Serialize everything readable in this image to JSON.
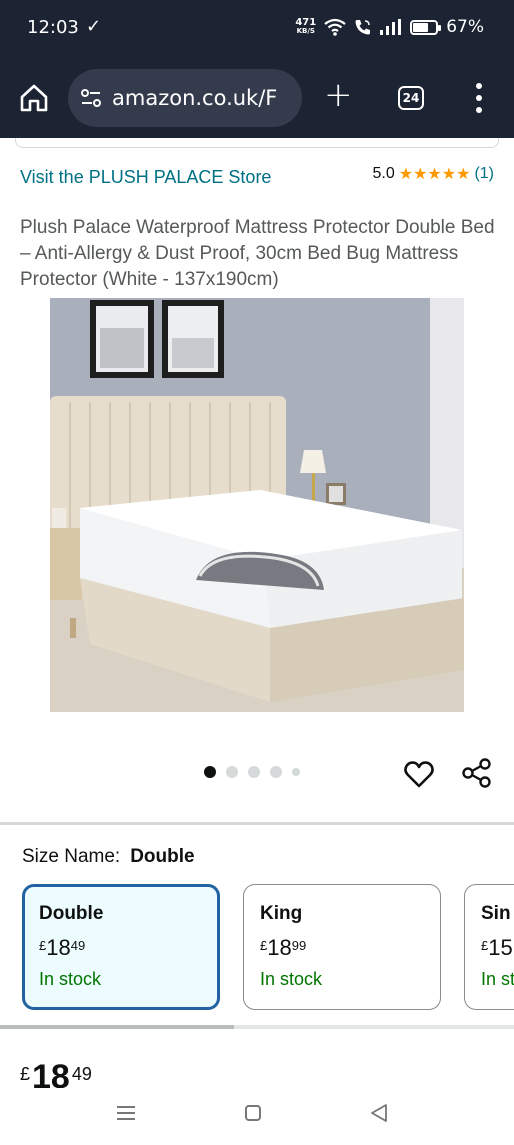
{
  "status_bar": {
    "time": "12:03",
    "check_glyph": "✓",
    "speed_value": "471",
    "speed_unit": "KB/S",
    "battery_percent": "67%",
    "battery_level": 0.67,
    "icons": [
      "download-check-icon",
      "wifi-icon",
      "wifi-calling-icon",
      "signal-icon",
      "battery-icon"
    ]
  },
  "browser": {
    "url": "amazon.co.uk/F",
    "tab_count": "24",
    "icons": [
      "home-icon",
      "site-settings-icon",
      "new-tab-plus-icon",
      "tab-switcher-icon",
      "overflow-menu-icon"
    ]
  },
  "product": {
    "store_link": "Visit the PLUSH PALACE Store",
    "rating_value": "5.0",
    "rating_stars": "★★★★★",
    "rating_count": "(1)",
    "title": "Plush Palace Waterproof Mattress Protector Double Bed – Anti-Allergy & Dust Proof, 30cm Bed Bug Mattress Protector (White - 137x190cm)"
  },
  "carousel": {
    "image_count": 5,
    "active_index": 0
  },
  "size": {
    "label": "Size Name:",
    "selected": "Double",
    "options": [
      {
        "name": "Double",
        "currency": "£",
        "whole": "18",
        "fraction": "49",
        "stock": "In stock"
      },
      {
        "name": "King",
        "currency": "£",
        "whole": "18",
        "fraction": "99",
        "stock": "In stock"
      },
      {
        "name": "Sin",
        "currency": "£",
        "whole": "15",
        "fraction": "",
        "stock": "In st"
      }
    ]
  },
  "price": {
    "currency": "£",
    "whole": "18",
    "fraction": "49"
  },
  "colors": {
    "chrome_bg": "#1c2333",
    "link": "#007185",
    "star": "#ff9900",
    "stock_green": "#007600",
    "selected_border": "#2162a1",
    "selected_bg": "#edfdff"
  }
}
